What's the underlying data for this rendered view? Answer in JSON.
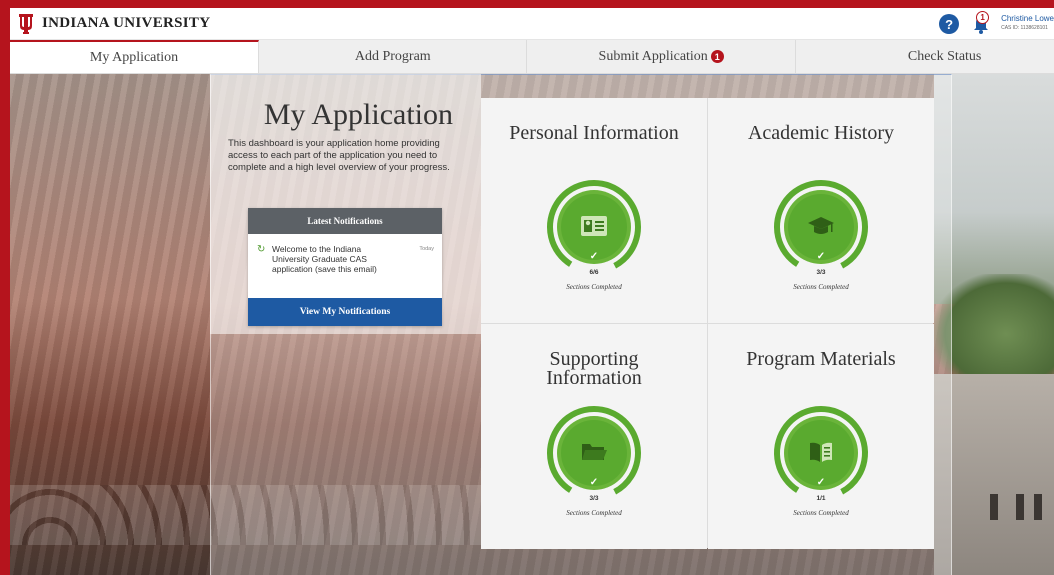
{
  "header": {
    "logo_text": "INDIANA UNIVERSITY",
    "help_icon": "?",
    "notification_count": "1",
    "user_name": "Christine Lowe",
    "cas_id": "CAS ID: 1138628101"
  },
  "tabs": [
    {
      "label": "My Application",
      "active": true
    },
    {
      "label": "Add Program"
    },
    {
      "label": "Submit Application",
      "badge": "1"
    },
    {
      "label": "Check Status"
    }
  ],
  "intro": {
    "title": "My Application",
    "description": "This dashboard is your application home providing access to each part of the application you need to complete and a high level overview of your progress."
  },
  "notifications": {
    "heading": "Latest Notifications",
    "message": "Welcome to the Indiana University Graduate CAS application (save this email)",
    "time": "Today",
    "button": "View My Notifications"
  },
  "tiles": [
    {
      "title": "Personal Information",
      "icon": "id-card-icon",
      "count": "6/6",
      "label": "Sections Completed",
      "progress": 1.0
    },
    {
      "title": "Academic History",
      "icon": "graduation-cap-icon",
      "count": "3/3",
      "label": "Sections Completed",
      "progress": 1.0
    },
    {
      "title": "Supporting Information",
      "icon": "folder-icon",
      "count": "3/3",
      "label": "Sections Completed",
      "progress": 1.0
    },
    {
      "title": "Program Materials",
      "icon": "book-icon",
      "count": "1/1",
      "label": "Sections Completed",
      "progress": 1.0
    }
  ],
  "colors": {
    "brand_red": "#b5141d",
    "progress_green": "#5aaa2f",
    "button_blue": "#1e5aa3"
  }
}
